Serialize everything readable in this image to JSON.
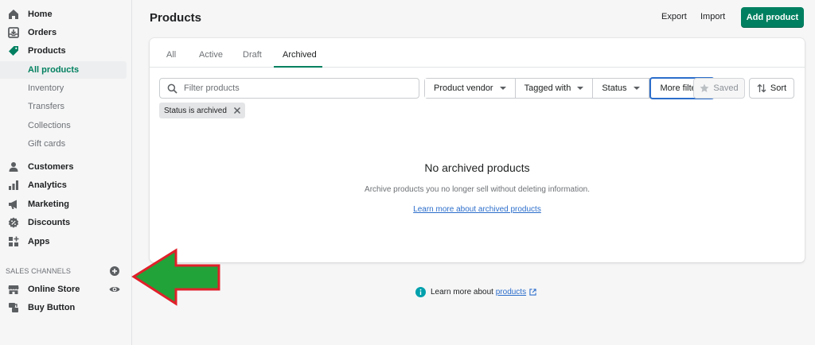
{
  "sidebar": {
    "nav": [
      {
        "label": "Home",
        "icon": "home-icon"
      },
      {
        "label": "Orders",
        "icon": "orders-icon"
      },
      {
        "label": "Products",
        "icon": "tag-icon"
      }
    ],
    "product_sub": [
      {
        "label": "All products",
        "active": true
      },
      {
        "label": "Inventory"
      },
      {
        "label": "Transfers"
      },
      {
        "label": "Collections"
      },
      {
        "label": "Gift cards"
      }
    ],
    "nav2": [
      {
        "label": "Customers",
        "icon": "person-icon"
      },
      {
        "label": "Analytics",
        "icon": "bar-chart-icon"
      },
      {
        "label": "Marketing",
        "icon": "megaphone-icon"
      },
      {
        "label": "Discounts",
        "icon": "discount-icon"
      },
      {
        "label": "Apps",
        "icon": "apps-icon"
      }
    ],
    "sales_channels_label": "SALES CHANNELS",
    "channels": [
      {
        "label": "Online Store",
        "icon": "store-icon"
      },
      {
        "label": "Buy Button",
        "icon": "buy-button-icon"
      }
    ]
  },
  "header": {
    "title": "Products",
    "export": "Export",
    "import": "Import",
    "add_product": "Add product"
  },
  "tabs": [
    {
      "label": "All"
    },
    {
      "label": "Active"
    },
    {
      "label": "Draft"
    },
    {
      "label": "Archived",
      "active": true
    }
  ],
  "filters": {
    "search_placeholder": "Filter products",
    "product_vendor": "Product vendor",
    "tagged_with": "Tagged with",
    "status": "Status",
    "more_filters": "More filters",
    "saved": "Saved",
    "sort": "Sort",
    "applied_tag": "Status is archived"
  },
  "empty_state": {
    "title": "No archived products",
    "description": "Archive products you no longer sell without deleting information.",
    "link": "Learn more about archived products"
  },
  "footer": {
    "text": "Learn more about",
    "link": "products"
  },
  "colors": {
    "primary": "#008060",
    "link": "#2c6ecb",
    "arrow_fill": "#22a33a",
    "arrow_stroke": "#e0202a"
  }
}
